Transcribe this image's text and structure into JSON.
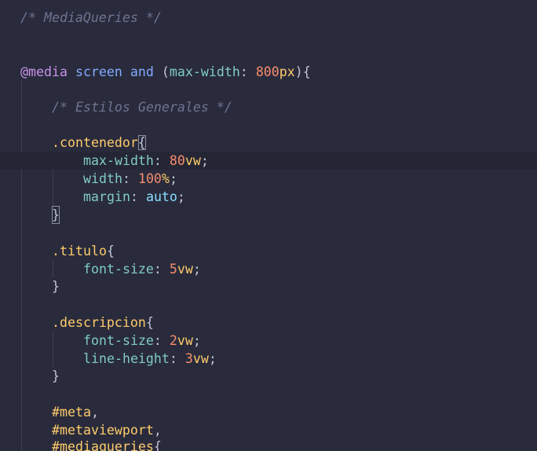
{
  "editor": {
    "comment_mediaqueries": "/* MediaQueries */",
    "media_line": {
      "at": "@media",
      "screen": "screen",
      "and": "and",
      "open_paren": "(",
      "prop": "max-width",
      "colon": ":",
      "num": "800",
      "unit": "px",
      "close": "){"
    },
    "comment_estilos": "/* Estilos Generales */",
    "contenedor": {
      "selector": ".contenedor",
      "open": "{",
      "max_width_prop": "max-width",
      "max_width_num": "80",
      "max_width_unit": "vw",
      "width_prop": "width",
      "width_num": "100",
      "width_unit": "%",
      "margin_prop": "margin",
      "margin_val": "auto",
      "close": "}"
    },
    "titulo": {
      "selector": ".titulo",
      "open": "{",
      "font_size_prop": "font-size",
      "font_size_num": "5",
      "font_size_unit": "vw",
      "close": "}"
    },
    "descripcion": {
      "selector": ".descripcion",
      "open": "{",
      "font_size_prop": "font-size",
      "font_size_num": "2",
      "font_size_unit": "vw",
      "line_height_prop": "line-height",
      "line_height_num": "3",
      "line_height_unit": "vw",
      "close": "}"
    },
    "ids": {
      "meta": "#meta",
      "metaviewport": "#metaviewport",
      "mediaqueries": "#mediaqueries",
      "comma": ",",
      "open": "{"
    },
    "semicolon": ";",
    "colon": ":"
  },
  "colors": {
    "background": "#292b3c",
    "active_line": "#252635",
    "comment": "#6f7391",
    "at_rule": "#c792ea",
    "keyword": "#82aaff",
    "property": "#80cbc4",
    "number": "#f78c6c",
    "unit_and_selector": "#ffcb6b",
    "value": "#89ddff"
  }
}
